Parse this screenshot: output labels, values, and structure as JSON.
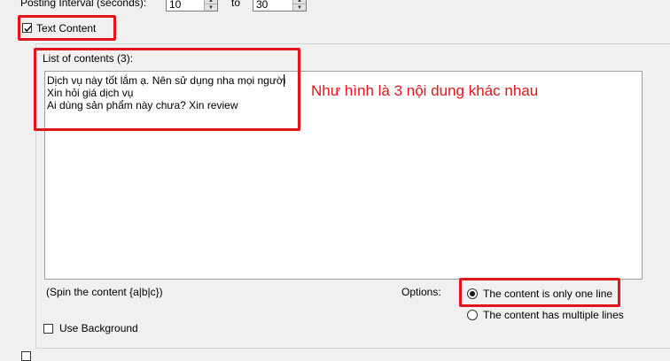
{
  "posting": {
    "label": "Posting Interval (seconds):",
    "from_value": "10",
    "to_label": "to",
    "to_value": "30"
  },
  "text_content": {
    "label": "Text Content",
    "checked": true
  },
  "list": {
    "label": "List of contents (3):",
    "lines": [
      "Dịch vụ này tốt lắm ạ. Nên sử dụng nha mọi người",
      "Xin hỏi giá dịch vụ",
      "Ai dùng sản phẩm này chưa? Xin review"
    ]
  },
  "annotation": {
    "text": "Như hình là 3 nội dung khác nhau",
    "color": "#e0161c"
  },
  "spin_hint": "(Spin the content {a|b|c})",
  "options": {
    "label": "Options:",
    "one_line": "The content is only one line",
    "multiple_lines": "The content has multiple lines",
    "selected": "one_line"
  },
  "use_background": {
    "label": "Use Background",
    "checked": false
  }
}
